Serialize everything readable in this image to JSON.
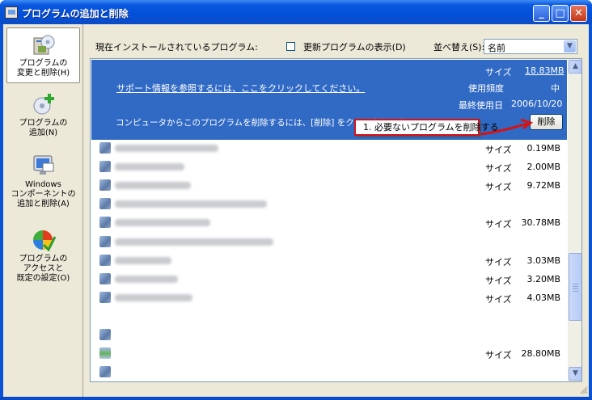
{
  "window": {
    "title": "プログラムの追加と削除",
    "controls": {
      "minimize": "_",
      "maximize": "□",
      "close": "✕"
    }
  },
  "sidebar": {
    "items": [
      {
        "label_lines": [
          "プログラムの",
          "変更と削除(H)"
        ],
        "icon": "change-remove-programs-icon",
        "active": true
      },
      {
        "label_lines": [
          "プログラムの",
          "追加(N)"
        ],
        "icon": "add-programs-icon",
        "active": false
      },
      {
        "label_lines": [
          "Windows",
          "コンポーネントの",
          "追加と削除(A)"
        ],
        "icon": "windows-components-icon",
        "active": false
      },
      {
        "label_lines": [
          "プログラムの",
          "アクセスと",
          "既定の設定(O)"
        ],
        "icon": "program-access-defaults-icon",
        "active": false
      }
    ]
  },
  "toolbar": {
    "installed_label": "現在インストールされているプログラム:",
    "show_updates_label": "更新プログラムの表示(D)",
    "show_updates_checked": false,
    "sort_label": "並べ替え(S):",
    "sort_value": "名前"
  },
  "selected_program": {
    "size_label": "サイズ",
    "size_value": "18.83MB",
    "support_link": "サポート情報を参照するには、ここをクリックしてください。",
    "frequency_label": "使用頻度",
    "frequency_value": "中",
    "last_used_label": "最終使用日",
    "last_used_value": "2006/10/20",
    "instruction": "コンピュータからこのプログラムを削除するには、[削除] をクリックします。",
    "remove_button": "削除"
  },
  "annotation": {
    "callout": "1. 必要ないプログラムを削除する",
    "color": "#d61212"
  },
  "programs": [
    {
      "size_label": "サイズ",
      "size": "0.19MB"
    },
    {
      "size_label": "サイズ",
      "size": "2.00MB"
    },
    {
      "size_label": "サイズ",
      "size": "9.72MB"
    },
    {
      "size_label": "",
      "size": ""
    },
    {
      "size_label": "サイズ",
      "size": "30.78MB"
    },
    {
      "size_label": "",
      "size": ""
    },
    {
      "size_label": "サイズ",
      "size": "3.03MB"
    },
    {
      "size_label": "サイズ",
      "size": "3.20MB"
    },
    {
      "size_label": "サイズ",
      "size": "4.03MB"
    },
    {
      "size_label": "",
      "size": ""
    },
    {
      "size_label": "",
      "size": ""
    },
    {
      "size_label": "サイズ",
      "size": "28.80MB"
    },
    {
      "size_label": "",
      "size": ""
    }
  ],
  "colors": {
    "titlebar": "#0a58e0",
    "selection": "#316ac5",
    "sidebar": "#ece9d8"
  }
}
